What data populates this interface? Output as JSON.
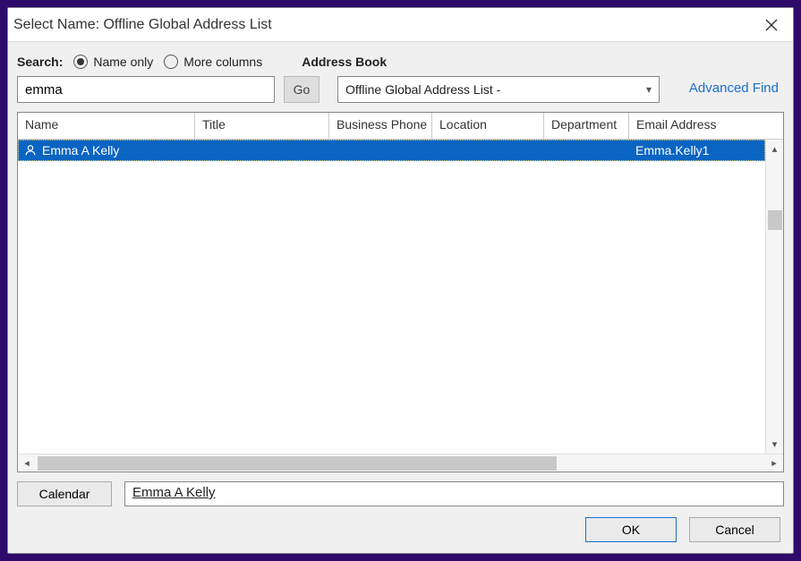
{
  "title": "Select Name: Offline Global Address List",
  "search": {
    "label": "Search:",
    "radio_name_only": "Name only",
    "radio_more_columns": "More columns",
    "input_value": "emma",
    "go_label": "Go"
  },
  "address_book": {
    "label": "Address Book",
    "selected": "Offline Global Address List -",
    "advanced_find": "Advanced Find"
  },
  "columns": {
    "name": "Name",
    "title": "Title",
    "phone": "Business Phone",
    "location": "Location",
    "dept": "Department",
    "email": "Email Address"
  },
  "rows": [
    {
      "name": "Emma A Kelly",
      "title": "",
      "phone": "",
      "location": "",
      "dept": "",
      "email": "Emma.Kelly1"
    }
  ],
  "calendar": {
    "button": "Calendar",
    "selected_name": "Emma A Kelly"
  },
  "footer": {
    "ok": "OK",
    "cancel": "Cancel"
  }
}
